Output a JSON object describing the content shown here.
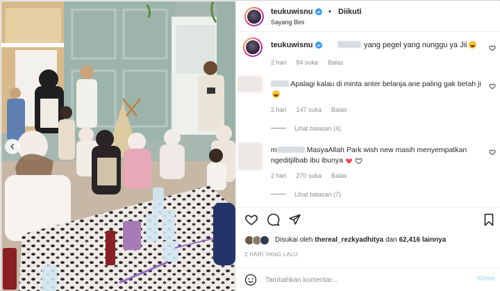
{
  "post": {
    "username": "teukuwisnu",
    "follow_label": "Diikuti",
    "subtitle": "Sayang Bini",
    "separator": "•"
  },
  "caption": {
    "username": "teukuwisnu",
    "text": "yang pegel yang nunggu ya Jii",
    "emoji": "laughing-emoji",
    "time": "2 hari",
    "likes": "84 suka",
    "reply_label": "Balas"
  },
  "comments": [
    {
      "text": "Apalagi kalau di minta anter belanja.ane paling gak betah ji",
      "emoji": "laughing-emoji",
      "time": "2 hari",
      "likes": "147 suka",
      "reply_label": "Balas",
      "view_replies": "Lihat balasan (4)"
    },
    {
      "prefix": "m",
      "text": "MasyaAllah Park wish new masih menyempatkan ngeditjilbab ibu ibunya",
      "time": "2 hari",
      "likes": "270 suka",
      "reply_label": "Balas",
      "view_replies": "Lihat balasan (7)"
    }
  ],
  "likes": {
    "prefix": "Disukai oleh",
    "user": "thereal_rezkyadhitya",
    "connector": "dan",
    "others": "62,416 lainnya"
  },
  "date_label": "2 HARI YANG LALU",
  "comment_box": {
    "placeholder": "Tambahkan komentar...",
    "send_label": "Kirim"
  },
  "icons": {
    "verified": "verified-badge-icon",
    "like": "heart-icon",
    "comment": "comment-icon",
    "share": "send-icon",
    "save": "bookmark-icon",
    "emoji_picker": "smile-icon",
    "carousel_prev": "chevron-left-icon"
  },
  "colors": {
    "verified_blue": "#3897f0",
    "text_primary": "#262626",
    "text_secondary": "#8e8e8e",
    "send_disabled": "#b2dffc",
    "heart_red": "#ed4956"
  }
}
